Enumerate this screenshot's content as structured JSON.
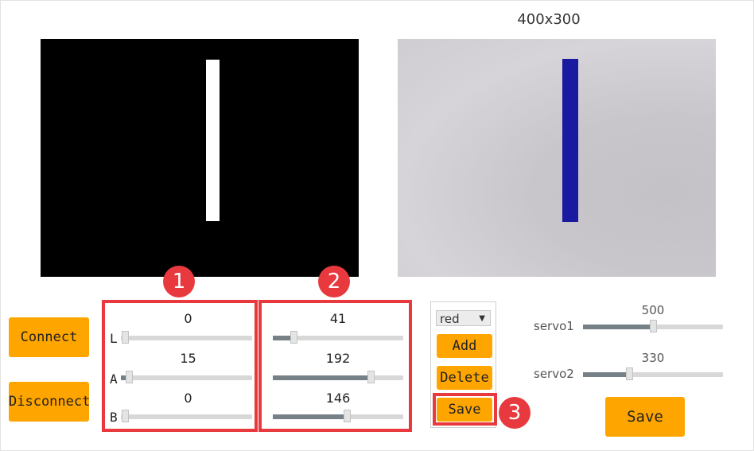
{
  "preview": {
    "resolution_label": "400x300"
  },
  "connection": {
    "connect_label": "Connect",
    "disconnect_label": "Disconnect"
  },
  "lab_min": {
    "sliders": [
      {
        "channel": "L",
        "value": "0",
        "level": 0.0
      },
      {
        "channel": "A",
        "value": "15",
        "level": 0.06
      },
      {
        "channel": "B",
        "value": "0",
        "level": 0.0
      }
    ]
  },
  "lab_max": {
    "sliders": [
      {
        "value": "41",
        "level": 0.16
      },
      {
        "value": "192",
        "level": 0.75
      },
      {
        "value": "146",
        "level": 0.57
      }
    ]
  },
  "color_panel": {
    "selected_color": "red",
    "add_label": "Add",
    "delete_label": "Delete",
    "save_label": "Save"
  },
  "servos": [
    {
      "label": "servo1",
      "value": "500",
      "level": 0.5
    },
    {
      "label": "servo2",
      "value": "330",
      "level": 0.33
    }
  ],
  "servo_save_label": "Save",
  "annotations": {
    "badge1": "1",
    "badge2": "2",
    "badge3": "3"
  },
  "colors": {
    "button": "#ffa500",
    "highlight": "#e8393f",
    "mask_background": "#000000",
    "detected_object": "#1a1aa0"
  }
}
